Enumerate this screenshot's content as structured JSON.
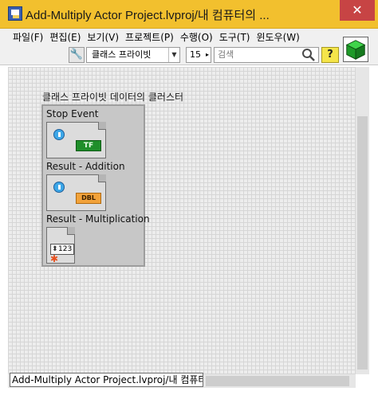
{
  "window": {
    "title": "Add-Multiply Actor Project.lvproj/내 컴퓨터의 ...",
    "close_label": "✕"
  },
  "menu": {
    "items": [
      "파일(F)",
      "편집(E)",
      "보기(V)",
      "프로젝트(P)",
      "수행(O)",
      "도구(T)",
      "윈도우(W)"
    ]
  },
  "toolbar": {
    "class_selector_value": "클래스 프라이빗",
    "font_size": "15",
    "search_placeholder": "검색",
    "help_label": "?"
  },
  "cluster": {
    "label": "클래스 프라이빗 데이터의 클러스터",
    "elements": [
      {
        "label": "Stop Event",
        "terminal": "TF"
      },
      {
        "label": "Result - Addition",
        "terminal": "DBL"
      },
      {
        "label": "Result - Multiplication",
        "terminal": "123"
      }
    ]
  },
  "statusbar": {
    "tab_label": "Add-Multiply Actor Project.lvproj/내 컴퓨터"
  },
  "colors": {
    "titlebar": "#f2c02e",
    "boolean_terminal": "#1f8e2a",
    "dbl_terminal": "#f2a23a"
  }
}
